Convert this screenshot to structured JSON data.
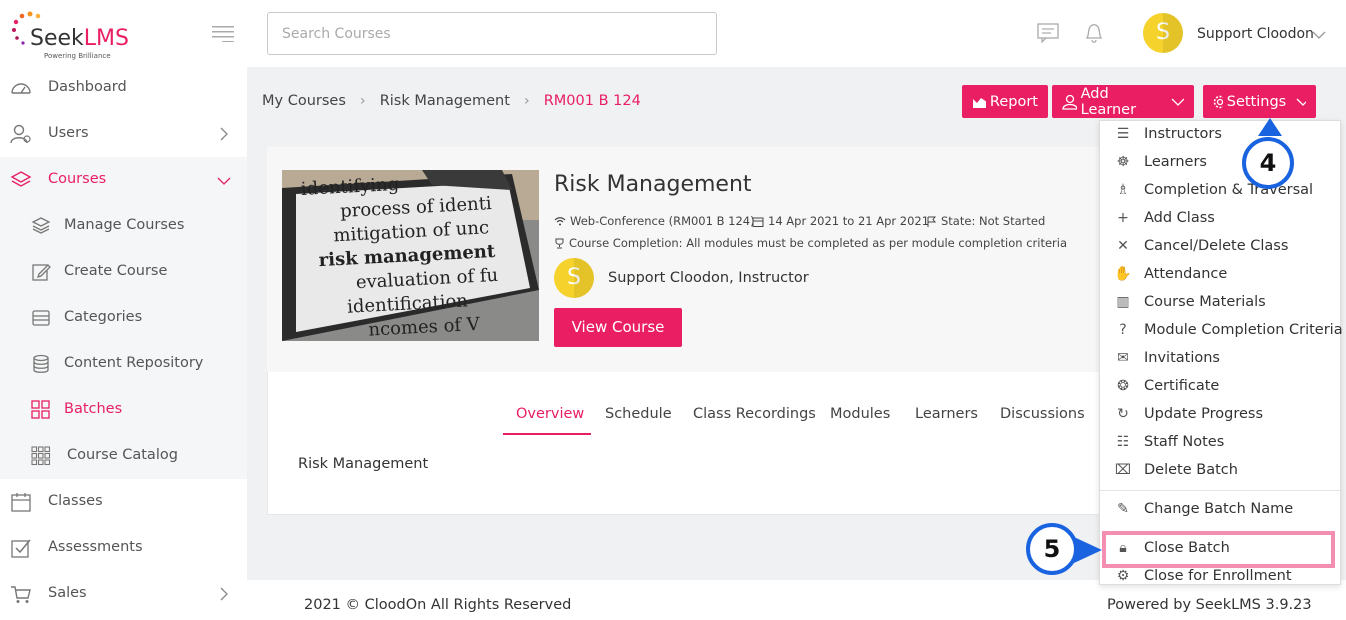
{
  "brand": {
    "name_part1": "Seek",
    "name_part2": "LMS",
    "tagline": "Powering Brilliance"
  },
  "search": {
    "placeholder": "Search Courses"
  },
  "user": {
    "name": "Support Cloodon",
    "initial": "S"
  },
  "sidebar": {
    "items": [
      {
        "label": "Dashboard",
        "icon": "dashboard-icon"
      },
      {
        "label": "Users",
        "icon": "users-icon"
      },
      {
        "label": "Courses",
        "icon": "layers-icon"
      },
      {
        "label": "Classes",
        "icon": "calendar-icon"
      },
      {
        "label": "Assessments",
        "icon": "checkbox-icon"
      },
      {
        "label": "Sales",
        "icon": "cart-icon"
      }
    ],
    "courses_sub": [
      {
        "label": "Manage Courses",
        "icon": "layers-icon"
      },
      {
        "label": "Create Course",
        "icon": "edit-icon"
      },
      {
        "label": "Categories",
        "icon": "categories-icon"
      },
      {
        "label": "Content Repository",
        "icon": "database-icon"
      },
      {
        "label": "Batches",
        "icon": "grid-icon"
      },
      {
        "label": "Course Catalog",
        "icon": "catalog-grid-icon"
      }
    ]
  },
  "breadcrumb": {
    "item1": "My Courses",
    "item2": "Risk Management",
    "current": "RM001 B 124"
  },
  "actions": {
    "report": "Report",
    "add_learner": "Add Learner",
    "settings": "Settings"
  },
  "course": {
    "title": "Risk Management",
    "type": "Web-Conference (RM001 B 124)",
    "dates": "14 Apr 2021 to 21 Apr 2021",
    "state": "State: Not Started",
    "completion": "Course Completion: All modules must be completed as per module completion criteria",
    "instructor": "Support Cloodon, Instructor",
    "view_button": "View Course",
    "image_lines": [
      "identifying",
      "process of identi",
      "mitigation of unc",
      "risk management",
      "evaluation of fu",
      "identification",
      "ncomes of V"
    ]
  },
  "tabs": [
    "Overview",
    "Schedule",
    "Class Recordings",
    "Modules",
    "Learners",
    "Discussions"
  ],
  "overview_text": "Risk Management",
  "settings_menu": {
    "items": [
      {
        "label": "Instructors",
        "icon": "instructors-icon"
      },
      {
        "label": "Learners",
        "icon": "learners-icon"
      },
      {
        "label": "Completion & Traversal",
        "icon": "trophy-icon"
      },
      {
        "label": "Add Class",
        "icon": "plus-icon"
      },
      {
        "label": "Cancel/Delete Class",
        "icon": "close-icon"
      },
      {
        "label": "Attendance",
        "icon": "hand-icon"
      },
      {
        "label": "Course Materials",
        "icon": "materials-icon"
      },
      {
        "label": "Module Completion Criteria",
        "icon": "question-icon"
      },
      {
        "label": "Invitations",
        "icon": "mail-icon"
      },
      {
        "label": "Certificate",
        "icon": "certificate-icon"
      },
      {
        "label": "Update Progress",
        "icon": "refresh-icon"
      },
      {
        "label": "Staff Notes",
        "icon": "notes-icon"
      },
      {
        "label": "Delete Batch",
        "icon": "trash-icon"
      }
    ],
    "change_name": "Change Batch Name",
    "close_batch": "Close Batch",
    "close_enrollment": "Close for Enrollment"
  },
  "annotations": {
    "step4": "4",
    "step5": "5"
  },
  "footer": {
    "copyright": "2021 © CloodOn All Rights Reserved",
    "powered": "Powered by SeekLMS 3.9.23"
  },
  "colors": {
    "accent": "#e91e63",
    "step_border": "#1a63e0",
    "highlight": "#f48fb1",
    "avatar": "#f5d22c"
  }
}
